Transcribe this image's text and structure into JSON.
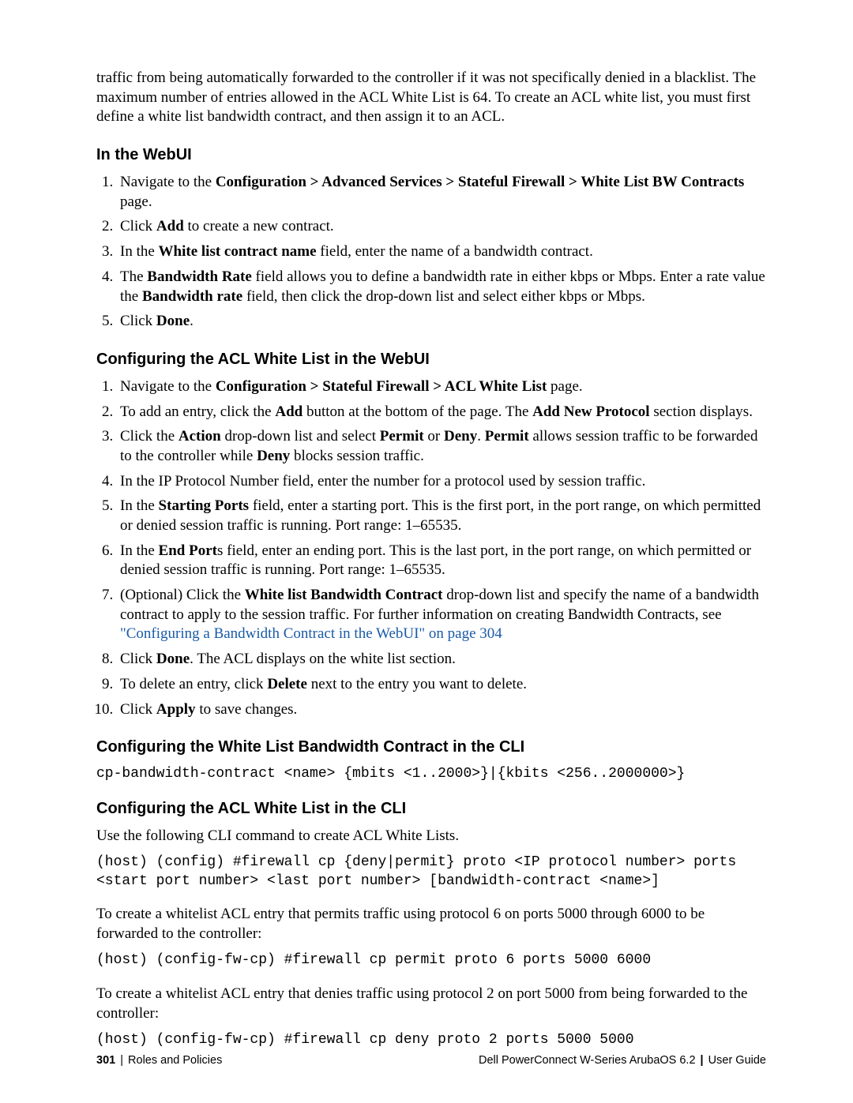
{
  "intro": "traffic from being automatically forwarded to the controller if it was not specifically denied in a blacklist. The maximum number of entries allowed in the ACL White List is 64. To create an ACL white list, you must first define a white list bandwidth contract, and then assign it to an ACL.",
  "sec1": {
    "heading": "In the WebUI",
    "items": {
      "i1a": "Navigate to the ",
      "i1b": "Configuration > Advanced Services > Stateful Firewall > White List BW Contracts",
      "i1c": " page.",
      "i2a": "Click ",
      "i2b": "Add",
      "i2c": " to create a new contract.",
      "i3a": "In the ",
      "i3b": "White list contract name",
      "i3c": " field, enter the name of a bandwidth contract.",
      "i4a": "The ",
      "i4b": "Bandwidth Rate",
      "i4c": " field allows you to define a bandwidth rate in either kbps or Mbps. Enter a rate value the ",
      "i4d": "Bandwidth rate",
      "i4e": " field, then click the drop-down list and select either kbps or Mbps.",
      "i5a": "Click ",
      "i5b": "Done",
      "i5c": "."
    }
  },
  "sec2": {
    "heading": "Configuring the ACL White List in the WebUI",
    "items": {
      "i1a": "Navigate to the ",
      "i1b": "Configuration > Stateful Firewall > ACL White List",
      "i1c": " page.",
      "i2a": "To add an entry, click the ",
      "i2b": "Add",
      "i2c": " button at the bottom of the page. The ",
      "i2d": "Add New Protocol",
      "i2e": " section displays.",
      "i3a": "Click the ",
      "i3b": "Action",
      "i3c": " drop-down list and select ",
      "i3d": "Permit",
      "i3e": " or ",
      "i3f": "Deny",
      "i3g": ". ",
      "i3h": "Permit",
      "i3i": " allows session traffic to be forwarded to the controller while ",
      "i3j": "Deny",
      "i3k": " blocks session traffic.",
      "i4": "In the IP Protocol Number field, enter the number for a protocol used by session traffic.",
      "i5a": "In the ",
      "i5b": "Starting Ports",
      "i5c": " field, enter a starting port. This is the first port, in the port range, on which permitted or denied session traffic is running. Port range: 1–65535.",
      "i6a": "In the ",
      "i6b": "End Port",
      "i6c": "s field, enter an ending port. This is the last port, in the port range, on which permitted or denied session traffic is running. Port range: 1–65535.",
      "i7a": "(Optional) Click the ",
      "i7b": "White list Bandwidth Contract",
      "i7c": " drop-down list and specify the name of a bandwidth contract to apply to the session traffic. For further information on creating Bandwidth Contracts, see ",
      "i7link": "\"Configuring a Bandwidth Contract in the WebUI\" on page 304",
      "i8a": "Click ",
      "i8b": "Done",
      "i8c": ". The ACL displays on the white list section.",
      "i9a": "To delete an entry, click ",
      "i9b": "Delete",
      "i9c": " next to the entry you want to delete.",
      "i10a": "Click ",
      "i10b": "Apply",
      "i10c": " to save changes."
    }
  },
  "sec3": {
    "heading": "Configuring the White List Bandwidth Contract in the CLI",
    "code": "cp-bandwidth-contract <name> {mbits <1..2000>}|{kbits <256..2000000>}"
  },
  "sec4": {
    "heading": "Configuring the ACL White List in the CLI",
    "p1": "Use the following CLI command to create ACL White Lists.",
    "code1": "(host) (config) #firewall cp {deny|permit} proto <IP protocol number> ports <start port number> <last port number> [bandwidth-contract <name>]",
    "p2": "To create a whitelist ACL entry that permits traffic using protocol 6 on ports 5000 through 6000 to be forwarded to the controller:",
    "code2": "(host) (config-fw-cp) #firewall cp permit proto 6 ports 5000 6000",
    "p3": "To create a whitelist ACL entry that denies traffic using protocol 2 on port 5000 from being forwarded to the controller:",
    "code3": "(host) (config-fw-cp) #firewall cp deny proto 2 ports 5000 5000"
  },
  "footer": {
    "page": "301",
    "leftSep": " | ",
    "leftTitle": "Roles and Policies",
    "rightProduct": "Dell PowerConnect W-Series ArubaOS 6.2",
    "rightSep": "  |  ",
    "rightDoc": "User Guide"
  }
}
